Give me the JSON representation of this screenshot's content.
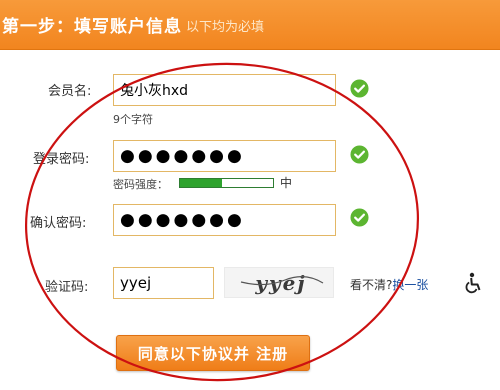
{
  "header": {
    "step_title": "第一步：填写账户信息",
    "subtitle": "以下均为必填"
  },
  "form": {
    "username": {
      "label": "会员名:",
      "value": "兔小灰hxd",
      "hint": "9个字符",
      "valid_icon": "check-circle-icon"
    },
    "password": {
      "label": "登录密码:",
      "value": "●●●●●●●",
      "valid_icon": "check-circle-icon",
      "strength_label": "密码强度：",
      "strength_level": "中",
      "strength_fraction": 0.45
    },
    "confirm_password": {
      "label": "确认密码:",
      "value": "●●●●●●●",
      "valid_icon": "check-circle-icon"
    },
    "captcha": {
      "label": "验证码:",
      "value": "yyej",
      "image_text": "yyej",
      "refresh_prompt": "看不清?",
      "refresh_link": "换一张",
      "accessibility_icon": "wheelchair-icon"
    },
    "submit_label": "同意以下协议并 注册"
  },
  "colors": {
    "header_bg": "#f2851f",
    "field_border": "#e3b765",
    "valid_green": "#5cb531",
    "strength_green": "#2ea32e",
    "annotation_red": "#cc1111",
    "link_blue": "#1a4fa0"
  }
}
